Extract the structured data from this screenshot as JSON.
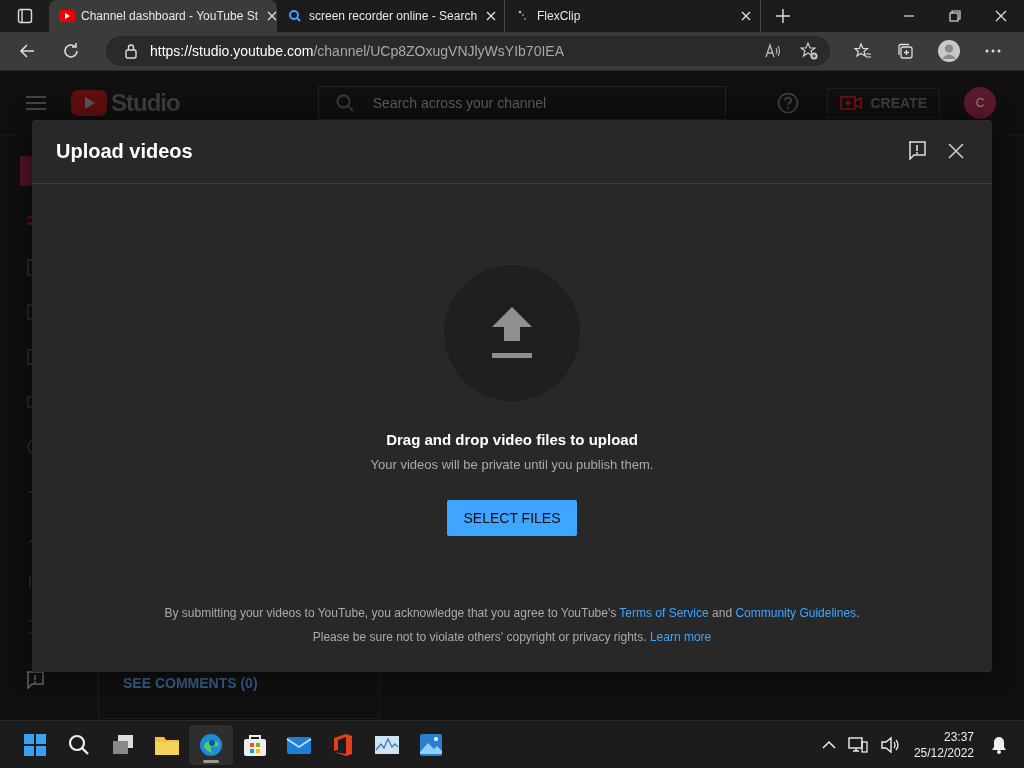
{
  "browser": {
    "tabs": [
      {
        "title": "Channel dashboard - YouTube St",
        "selected": true
      },
      {
        "title": "screen recorder online - Search",
        "selected": false
      },
      {
        "title": "FlexClip",
        "selected": false
      }
    ],
    "url": {
      "host": "https://studio.youtube.com",
      "path": "/channel/UCp8ZOxugVNJlyWsYIb70IEA"
    }
  },
  "studio": {
    "logo": "Studio",
    "search": {
      "placeholder": "Search across your channel"
    },
    "create_button": "CREATE",
    "avatar": "C",
    "comments_link": "SEE COMMENTS (0)"
  },
  "dialog": {
    "title": "Upload videos",
    "heading": "Drag and drop video files to upload",
    "subtext": "Your videos will be private until you publish them.",
    "button": "SELECT FILES",
    "legal": [
      [
        {
          "kind": "text",
          "text": "By submitting your videos to YouTube, you acknowledge that you agree to YouTube's "
        },
        {
          "kind": "link",
          "text": "Terms of Service"
        },
        {
          "kind": "text",
          "text": " and "
        },
        {
          "kind": "link",
          "text": "Community Guidelines"
        },
        {
          "kind": "text",
          "text": "."
        }
      ],
      [
        {
          "kind": "text",
          "text": "Please be sure not to violate others' copyright or privacy rights. "
        },
        {
          "kind": "link",
          "text": "Learn more"
        }
      ]
    ]
  },
  "taskbar": {
    "apps": [
      {
        "selected": false
      },
      {
        "selected": false
      },
      {
        "selected": false
      },
      {
        "selected": false
      },
      {
        "selected": true
      },
      {
        "selected": false
      },
      {
        "selected": false
      },
      {
        "selected": false
      },
      {
        "selected": false
      },
      {
        "selected": false
      }
    ],
    "time": "23:37",
    "date": "25/12/2022"
  }
}
